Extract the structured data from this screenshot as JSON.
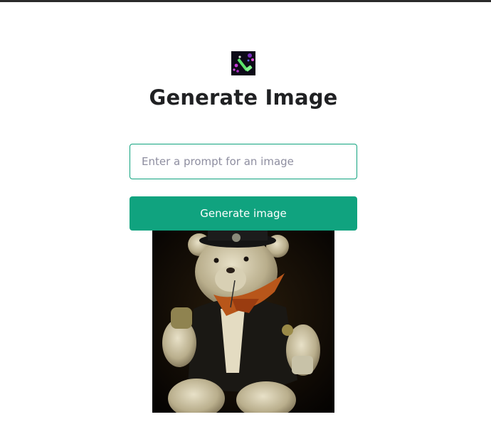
{
  "page": {
    "title": "Generate Image"
  },
  "logo": {
    "icon": "paintbrush-logo-icon",
    "colors": [
      "#0d0a18",
      "#c43bd6",
      "#5be36a"
    ]
  },
  "form": {
    "prompt_placeholder": "Enter a prompt for an image",
    "prompt_value": "",
    "submit_label": "Generate image"
  },
  "result": {
    "image_subject": "generated-image"
  },
  "colors": {
    "accent": "#10a37f",
    "title": "#202123",
    "placeholder": "#8e8ea0",
    "top_bar": "#2b2b2b"
  }
}
